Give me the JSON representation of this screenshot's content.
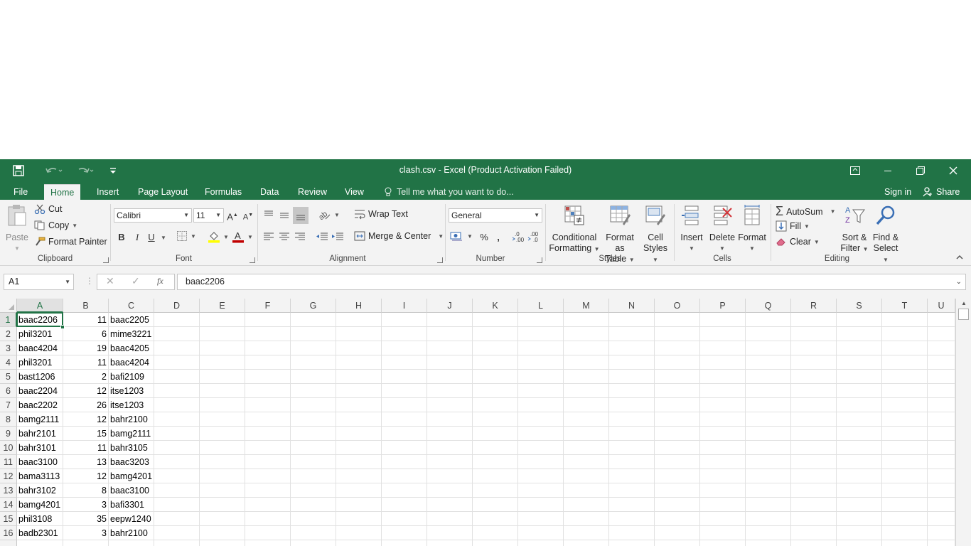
{
  "window": {
    "title": "clash.csv - Excel (Product Activation Failed)",
    "accent": "#217346"
  },
  "tabs": [
    "File",
    "Home",
    "Insert",
    "Page Layout",
    "Formulas",
    "Data",
    "Review",
    "View"
  ],
  "active_tab": "Home",
  "tell_me": "Tell me what you want to do...",
  "account": {
    "sign_in": "Sign in",
    "share": "Share"
  },
  "ribbon": {
    "clipboard": {
      "paste": "Paste",
      "cut": "Cut",
      "copy": "Copy",
      "format_painter": "Format Painter",
      "label": "Clipboard"
    },
    "font": {
      "name": "Calibri",
      "size": "11",
      "bold": "B",
      "italic": "I",
      "underline": "U",
      "label": "Font"
    },
    "alignment": {
      "wrap_text": "Wrap Text",
      "merge_center": "Merge & Center",
      "label": "Alignment"
    },
    "number": {
      "format": "General",
      "percent": "%",
      "comma": ",",
      "label": "Number"
    },
    "styles": {
      "conditional_1": "Conditional",
      "conditional_2": "Formatting",
      "format_table_1": "Format as",
      "format_table_2": "Table",
      "cell_styles_1": "Cell",
      "cell_styles_2": "Styles",
      "label": "Styles"
    },
    "cells": {
      "insert": "Insert",
      "delete": "Delete",
      "format": "Format",
      "label": "Cells"
    },
    "editing": {
      "autosum": "AutoSum",
      "fill": "Fill",
      "clear": "Clear",
      "sort_1": "Sort &",
      "sort_2": "Filter",
      "find_1": "Find &",
      "find_2": "Select",
      "label": "Editing"
    }
  },
  "formula_bar": {
    "name_box": "A1",
    "fx": "fx",
    "value": "baac2206"
  },
  "columns": [
    "A",
    "B",
    "C",
    "D",
    "E",
    "F",
    "G",
    "H",
    "I",
    "J",
    "K",
    "L",
    "M",
    "N",
    "O",
    "P",
    "Q",
    "R",
    "S",
    "T",
    "U"
  ],
  "rows": [
    {
      "n": "1",
      "a": "baac2206",
      "b": "11",
      "c": "baac2205"
    },
    {
      "n": "2",
      "a": "phil3201",
      "b": "6",
      "c": "mime3221"
    },
    {
      "n": "3",
      "a": "baac4204",
      "b": "19",
      "c": "baac4205"
    },
    {
      "n": "4",
      "a": "phil3201",
      "b": "11",
      "c": "baac4204"
    },
    {
      "n": "5",
      "a": "bast1206",
      "b": "2",
      "c": "bafi2109"
    },
    {
      "n": "6",
      "a": "baac2204",
      "b": "12",
      "c": "itse1203"
    },
    {
      "n": "7",
      "a": "baac2202",
      "b": "26",
      "c": "itse1203"
    },
    {
      "n": "8",
      "a": "bamg2111",
      "b": "12",
      "c": "bahr2100"
    },
    {
      "n": "9",
      "a": "bahr2101",
      "b": "15",
      "c": "bamg2111"
    },
    {
      "n": "10",
      "a": "bahr3101",
      "b": "11",
      "c": "bahr3105"
    },
    {
      "n": "11",
      "a": "baac3100",
      "b": "13",
      "c": "baac3203"
    },
    {
      "n": "12",
      "a": "bama3113",
      "b": "12",
      "c": "bamg4201"
    },
    {
      "n": "13",
      "a": "bahr3102",
      "b": "8",
      "c": "baac3100"
    },
    {
      "n": "14",
      "a": "bamg4201",
      "b": "3",
      "c": "bafi3301"
    },
    {
      "n": "15",
      "a": "phil3108",
      "b": "35",
      "c": "eepw1240"
    },
    {
      "n": "16",
      "a": "badb2301",
      "b": "3",
      "c": "bahr2100"
    }
  ]
}
